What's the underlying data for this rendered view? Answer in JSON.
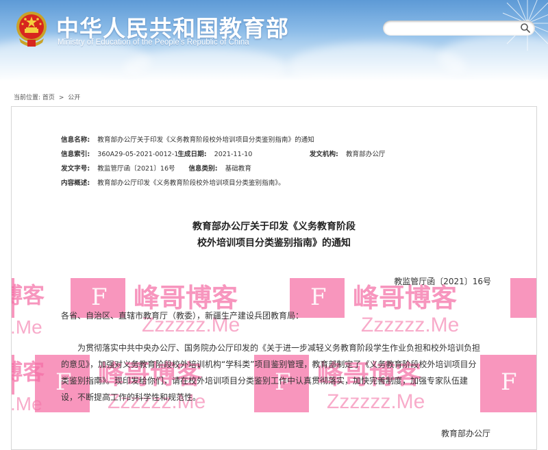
{
  "header": {
    "title": "中华人民共和国教育部",
    "subtitle": "Ministry of Education of the People's Republic of China",
    "search_placeholder": ""
  },
  "breadcrumb": {
    "label": "当前位置:",
    "items": [
      "首页",
      "公开"
    ],
    "separator": ">"
  },
  "info": {
    "name_label": "信息名称:",
    "name_value": "教育部办公厅关于印发《义务教育阶段校外培训项目分类鉴别指南》的通知",
    "index_label": "信息索引:",
    "index_value": "360A29-05-2021-0012-1",
    "date_label": "生成日期:",
    "date_value": "2021-11-10",
    "issuer_label": "发文机构:",
    "issuer_value": "教育部办公厅",
    "docno_label": "发文字号:",
    "docno_value": "教监管厅函〔2021〕16号",
    "category_label": "信息类别:",
    "category_value": "基础教育",
    "summary_label": "内容概述:",
    "summary_value": "教育部办公厅印发《义务教育阶段校外培训项目分类鉴别指南》。"
  },
  "document": {
    "title_line1": "教育部办公厅关于印发《义务教育阶段",
    "title_line2": "校外培训项目分类鉴别指南》的通知",
    "number": "教监管厅函〔2021〕16号",
    "salutation": "各省、自治区、直辖市教育厅（教委），新疆生产建设兵团教育局：",
    "paragraph": "为贯彻落实中共中央办公厅、国务院办公厅印发的《关于进一步减轻义务教育阶段学生作业负担和校外培训负担的意见》，加强对义务教育阶段校外培训机构“学科类”项目鉴别管理，教育部制定了《义务教育阶段校外培训项目分类鉴别指南》。现印发给你们，请在校外培训项目分类鉴别工作中认真贯彻落实，加快完善制度，加强专家队伍建设，不断提高工作的科学性和规范性。",
    "signature": "教育部办公厅"
  },
  "watermark": {
    "text": "峰哥博客",
    "partial_text": "博客",
    "url": "Zzzzzz.Me",
    "partial_url": "z.Me",
    "letter": "F",
    "color": "#f46ea5"
  },
  "icons": {
    "emblem": "national-emblem-icon",
    "search": "search-icon"
  }
}
